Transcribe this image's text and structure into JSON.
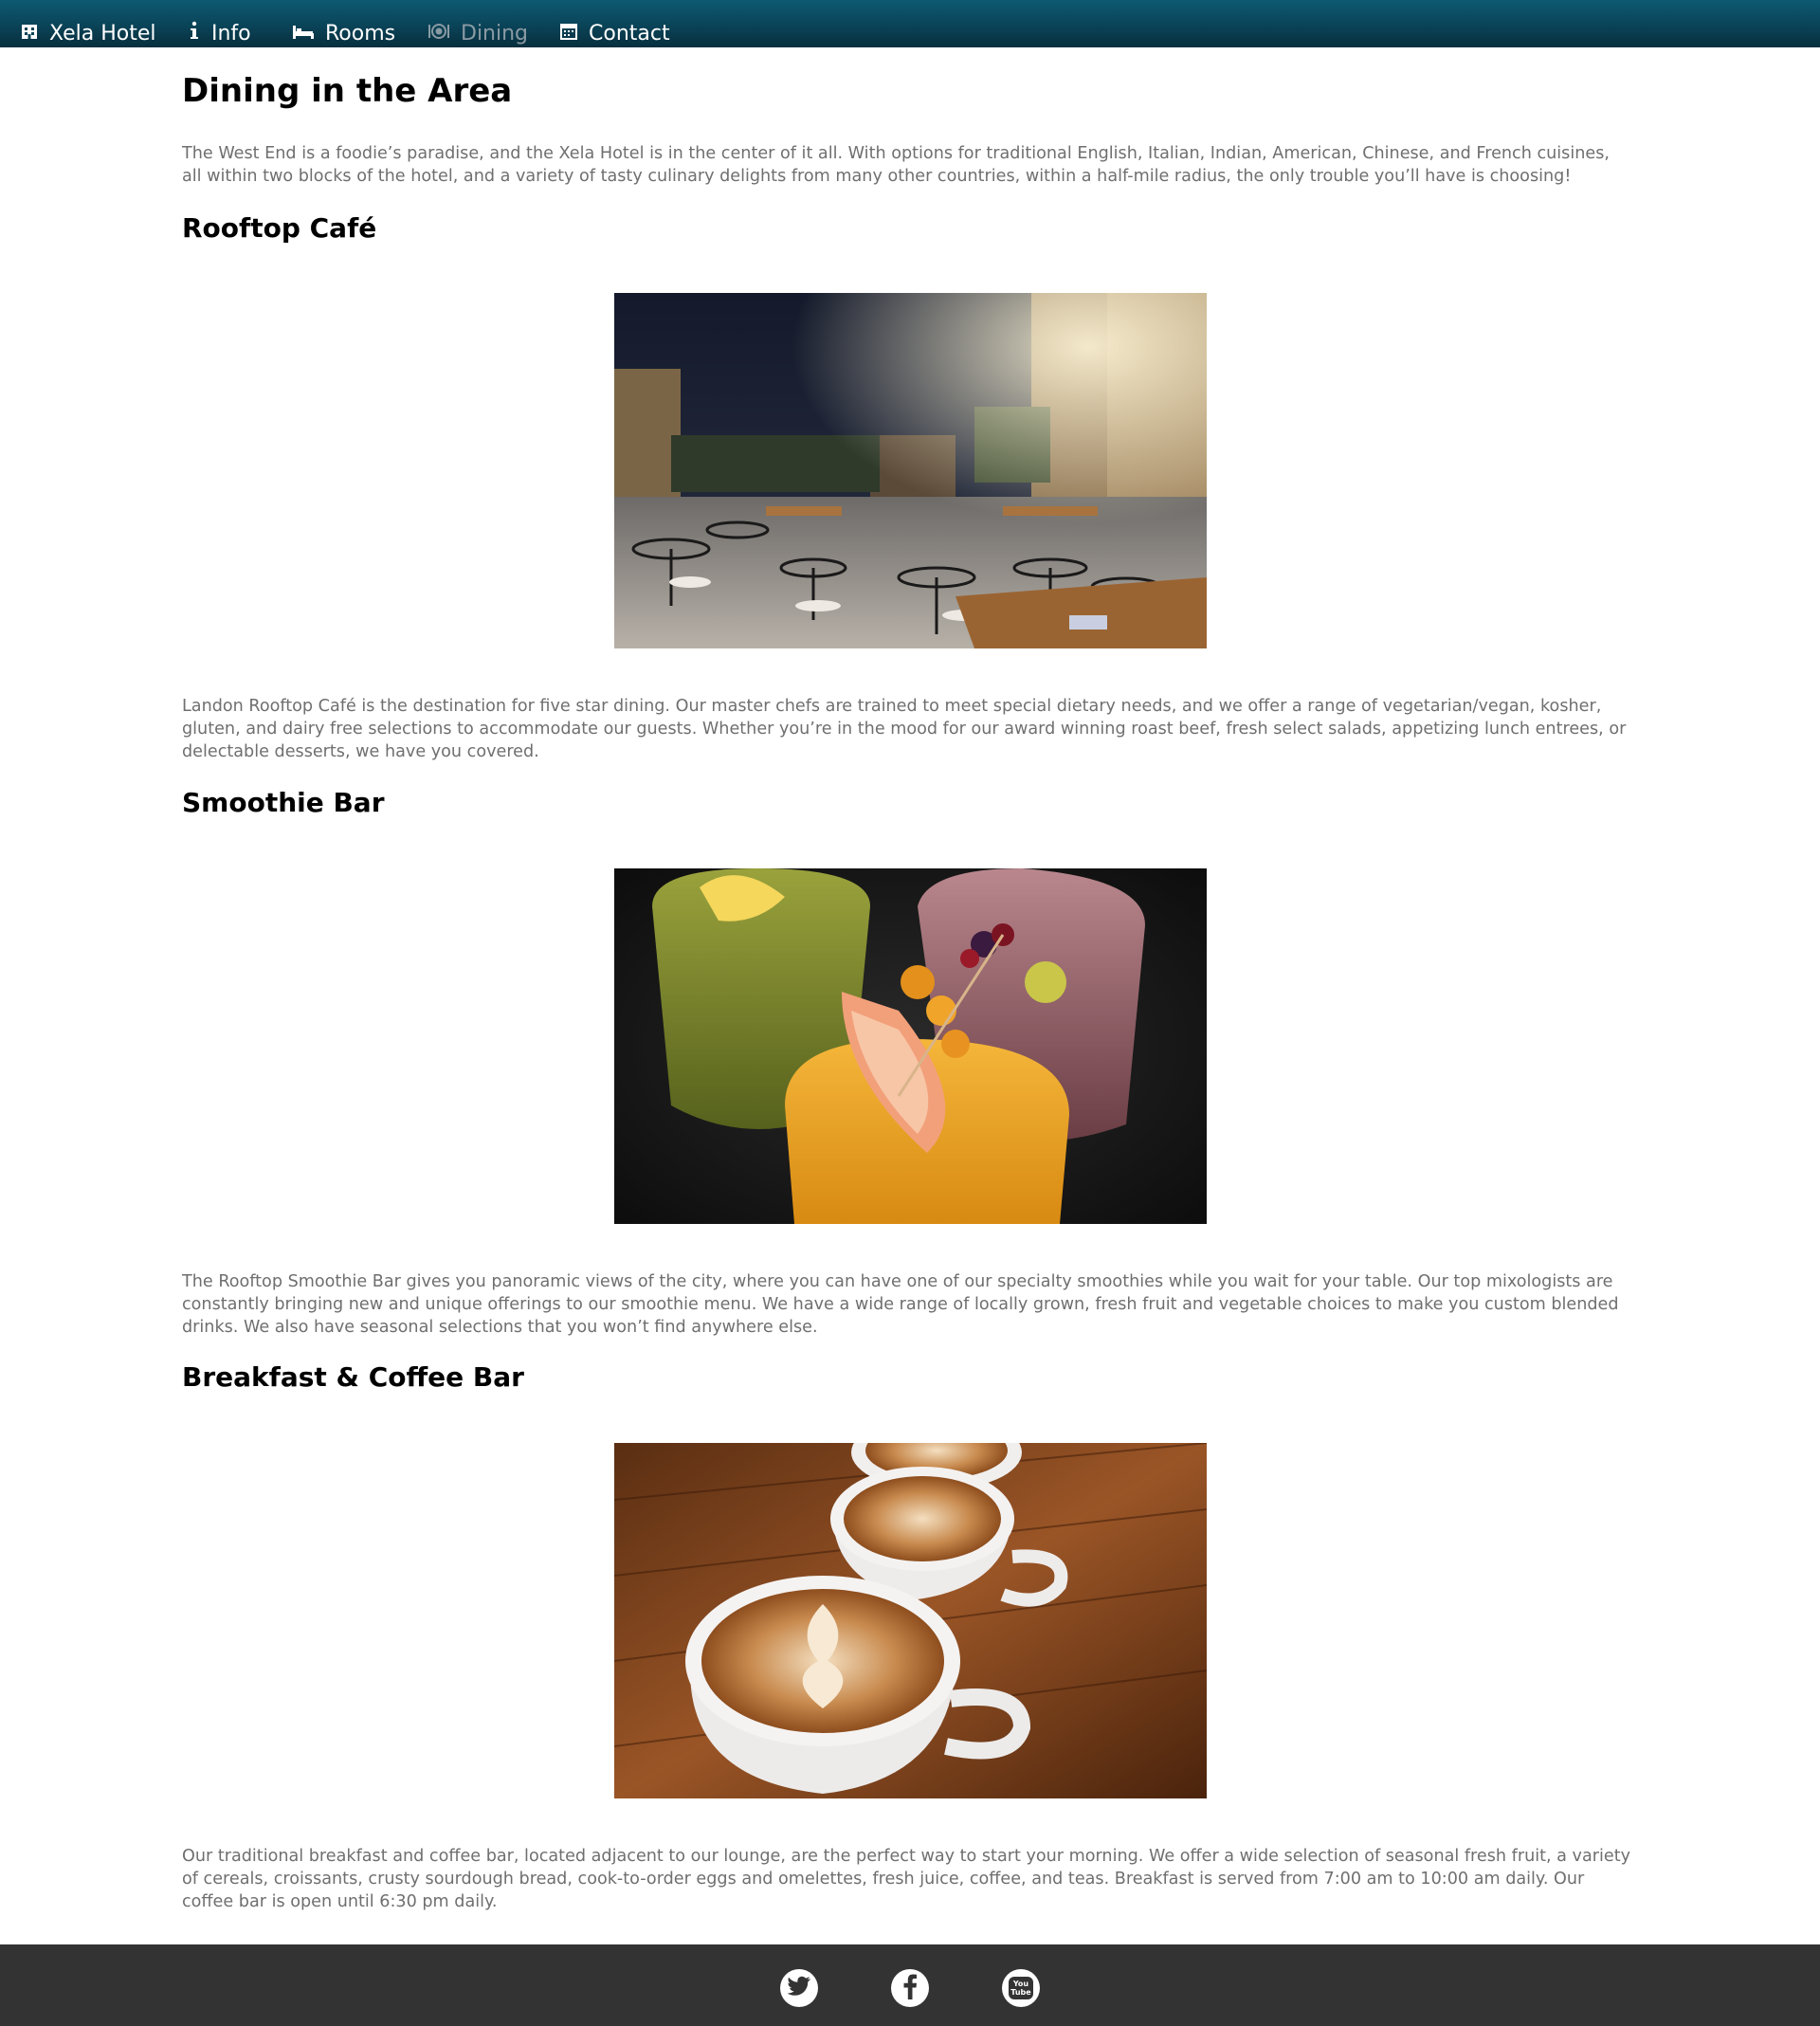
{
  "nav": {
    "brand": "Xela Hotel",
    "items": [
      {
        "label": "Info",
        "icon": "info-icon"
      },
      {
        "label": "Rooms",
        "icon": "bed-icon"
      },
      {
        "label": "Dining",
        "icon": "dining-icon",
        "active": true
      },
      {
        "label": "Contact",
        "icon": "calendar-icon"
      }
    ],
    "colors": {
      "bar": "#0a4357",
      "active": "#8a9aa3"
    }
  },
  "page": {
    "title": "Dining in the Area",
    "intro": "The West End is a foodie’s paradise, and the Xela Hotel is in the center of it all. With options for traditional English, Italian, Indian, American, Chinese, and French cuisines, all within two blocks of the hotel, and a variety of tasty culinary delights from many other countries, within a half-mile radius, the only trouble you’ll have is choosing!"
  },
  "sections": [
    {
      "heading": "Rooftop Café",
      "image": "rooftop-cafe-photo",
      "text": "Landon Rooftop Café is the destination for five star dining. Our master chefs are trained to meet special dietary needs, and we offer a range of vegetarian/vegan, kosher, gluten, and dairy free selections to accommodate our guests. Whether you’re in the mood for our award winning roast beef, fresh select salads, appetizing lunch entrees, or delectable desserts, we have you covered."
    },
    {
      "heading": "Smoothie Bar",
      "image": "smoothie-photo",
      "text": "The Rooftop Smoothie Bar gives you panoramic views of the city, where you can have one of our specialty smoothies while you wait for your table. Our top mixologists are constantly bringing new and unique offerings to our smoothie menu. We have a wide range of locally grown, fresh fruit and vegetable choices to make you custom blended drinks. We also have seasonal selections that you won’t find anywhere else."
    },
    {
      "heading": "Breakfast & Coffee Bar",
      "image": "coffee-photo",
      "text": "Our traditional breakfast and coffee bar, located adjacent to our lounge, are the perfect way to start your morning. We offer a wide selection of seasonal fresh fruit, a variety of cereals, croissants, crusty sourdough bread, cook-to-order eggs and omelettes, fresh juice, coffee, and teas. Breakfast is served from 7:00 am to 10:00 am daily. Our coffee bar is open until 6:30 pm daily."
    }
  ],
  "footer": {
    "social": [
      {
        "name": "twitter-icon"
      },
      {
        "name": "facebook-icon"
      },
      {
        "name": "youtube-icon",
        "label_top": "You",
        "label_bottom": "Tube"
      }
    ],
    "background": "#333333"
  }
}
